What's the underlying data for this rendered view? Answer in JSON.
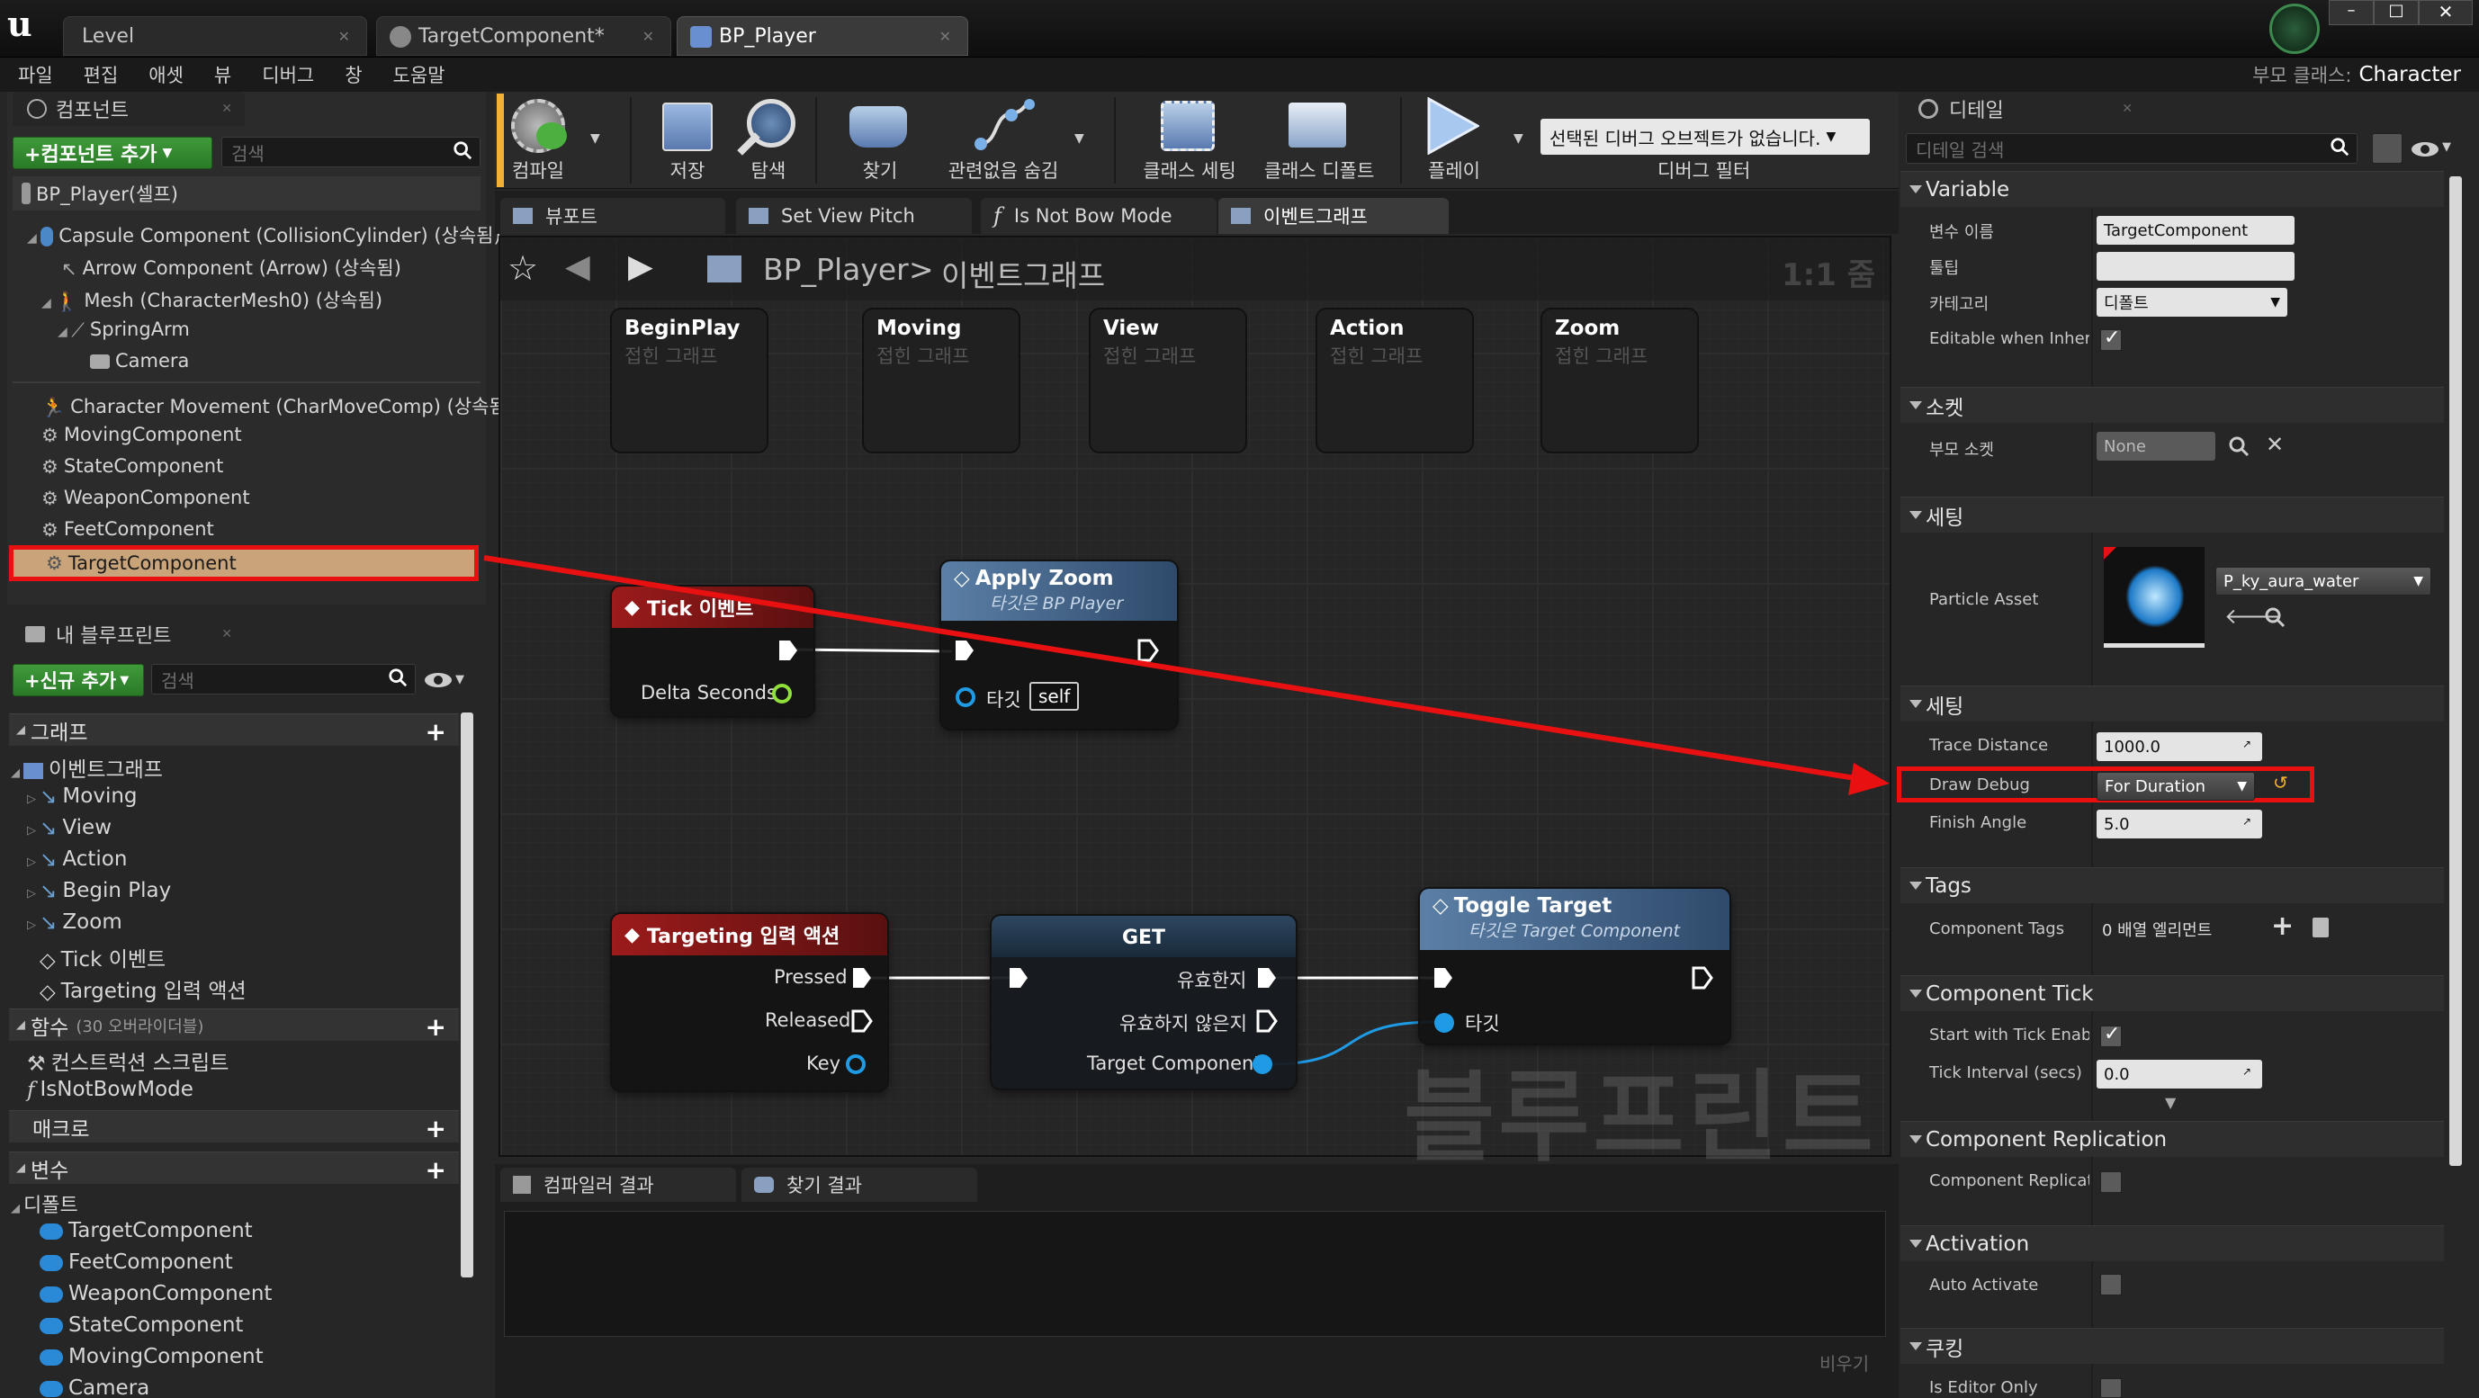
{
  "title_tabs": [
    {
      "label": "Level"
    },
    {
      "label": "TargetComponent*"
    },
    {
      "label": "BP_Player"
    }
  ],
  "menu": [
    "파일",
    "편집",
    "애셋",
    "뷰",
    "디버그",
    "창",
    "도움말"
  ],
  "parent_class": {
    "label": "부모 클래스:",
    "value": "Character"
  },
  "components": {
    "header": "컴포넌트",
    "add_button": "+컴포넌트 추가",
    "search_placeholder": "검색",
    "self": "BP_Player(셀프)",
    "items": [
      "Capsule Component (CollisionCylinder) (상속됨)",
      "Arrow Component (Arrow) (상속됨)",
      "Mesh (CharacterMesh0) (상속됨)",
      "SpringArm",
      "Camera",
      "Character Movement (CharMoveComp) (상속됨)",
      "MovingComponent",
      "StateComponent",
      "WeaponComponent",
      "FeetComponent",
      "TargetComponent"
    ]
  },
  "my_blueprint": {
    "header": "내 블루프린트",
    "add_button": "+신규 추가",
    "search_placeholder": "검색",
    "graph_section": "그래프",
    "event_graph": "이벤트그래프",
    "graph_items": [
      "Moving",
      "View",
      "Action",
      "Begin Play",
      "Zoom",
      "Tick 이벤트",
      "Targeting 입력 액션"
    ],
    "functions_section": "함수",
    "functions_note": "(30 오버라이더블)",
    "function_items": [
      "컨스트럭션 스크립트",
      "IsNotBowMode"
    ],
    "macros_section": "매크로",
    "variables_section": "변수",
    "default_section": "디폴트",
    "variable_items": [
      "TargetComponent",
      "FeetComponent",
      "WeaponComponent",
      "StateComponent",
      "MovingComponent",
      "Camera"
    ]
  },
  "toolbar": {
    "buttons": [
      "컴파일",
      "저장",
      "탐색",
      "찾기",
      "관련없음 숨김",
      "클래스 세팅",
      "클래스 디폴트",
      "플레이"
    ],
    "debug_select": "선택된 디버그 오브젝트가 없습니다.",
    "debug_filter": "디버그 필터"
  },
  "graph_tabs": [
    "뷰포트",
    "Set View Pitch",
    "Is Not Bow Mode",
    "이벤트그래프"
  ],
  "breadcrumb": {
    "root": "BP_Player",
    "sep": ">",
    "page": "이벤트그래프",
    "zoom": "1:1 줌"
  },
  "collapsed_nodes": [
    {
      "title": "BeginPlay",
      "sub": "접힌 그래프"
    },
    {
      "title": "Moving",
      "sub": "접힌 그래프"
    },
    {
      "title": "View",
      "sub": "접힌 그래프"
    },
    {
      "title": "Action",
      "sub": "접힌 그래프"
    },
    {
      "title": "Zoom",
      "sub": "접힌 그래프"
    }
  ],
  "nodes": {
    "tick": {
      "title": "Tick 이벤트",
      "pin": "Delta Seconds"
    },
    "apply_zoom": {
      "title": "Apply Zoom",
      "sub": "타깃은 BP Player",
      "target_label": "타깃",
      "target_value": "self"
    },
    "targeting": {
      "title": "Targeting 입력 액션",
      "pins": [
        "Pressed",
        "Released",
        "Key"
      ]
    },
    "get": {
      "title": "GET",
      "pins": [
        "유효한지",
        "유효하지 않은지"
      ],
      "input": "Target Component"
    },
    "toggle": {
      "title": "Toggle Target",
      "sub": "타깃은 Target Component",
      "target_label": "타깃"
    }
  },
  "watermark": "블루프린트",
  "bottom_tabs": [
    "컴파일러 결과",
    "찾기 결과"
  ],
  "bottom_clear": "비우기",
  "details": {
    "header": "디테일",
    "search_placeholder": "디테일 검색",
    "variable": {
      "section": "Variable",
      "rows": [
        {
          "label": "변수 이름",
          "value": "TargetComponent"
        },
        {
          "label": "툴팁",
          "value": ""
        },
        {
          "label": "카테고리",
          "value": "디폴트"
        },
        {
          "label": "Editable when Inherit"
        }
      ]
    },
    "socket": {
      "section": "소켓",
      "label": "부모 소켓",
      "value": "None"
    },
    "setting1": {
      "section": "세팅",
      "label": "Particle Asset",
      "value": "P_ky_aura_water"
    },
    "setting2": {
      "section": "세팅",
      "rows": [
        {
          "label": "Trace Distance",
          "value": "1000.0"
        },
        {
          "label": "Draw Debug",
          "value": "For Duration"
        },
        {
          "label": "Finish Angle",
          "value": "5.0"
        }
      ]
    },
    "tags": {
      "section": "Tags",
      "label": "Component Tags",
      "value": "0 배열 엘리먼트"
    },
    "tick": {
      "section": "Component Tick",
      "rows": [
        {
          "label": "Start with Tick Enable"
        },
        {
          "label": "Tick Interval (secs)",
          "value": "0.0"
        }
      ]
    },
    "replication": {
      "section": "Component Replication",
      "label": "Component Replicate"
    },
    "activation": {
      "section": "Activation",
      "label": "Auto Activate"
    },
    "cooking": {
      "section": "쿠킹",
      "label": "Is Editor Only"
    }
  },
  "colors": {
    "highlight": "#e81010",
    "accent": "#f2b035",
    "exec": "#ffffff",
    "object_pin": "#1f9be6"
  }
}
